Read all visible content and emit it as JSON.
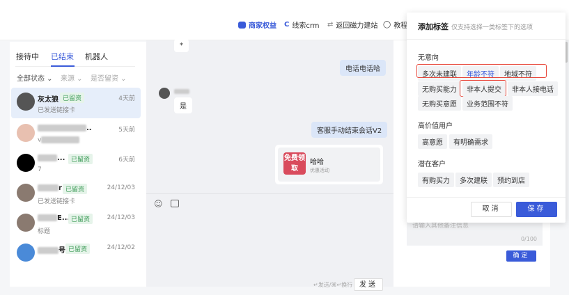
{
  "header": {
    "nav": [
      {
        "icon": "vip-icon",
        "label": "商家权益"
      },
      {
        "icon": "crm-icon",
        "label": "线索crm"
      },
      {
        "icon": "swap-icon",
        "label": "返回磁力建站"
      },
      {
        "icon": "tutorial-icon",
        "label": "教程"
      }
    ]
  },
  "sidebar": {
    "tabs": [
      "接待中",
      "已结束",
      "机器人"
    ],
    "filters": [
      "全部状态",
      "来源",
      "是否留资"
    ],
    "conversations": [
      {
        "name": "灰太狼",
        "badge": "已留资",
        "time": "4天前",
        "preview": "已发送链接卡"
      },
      {
        "name": "..",
        "badge": "",
        "time": "5天前",
        "preview": "v"
      },
      {
        "name": "...",
        "badge": "已留资",
        "time": "6天前",
        "preview": "7"
      },
      {
        "name": "r",
        "badge": "已留资",
        "time": "24/12/03",
        "preview": "已发送链接卡"
      },
      {
        "name": "E...",
        "badge": "已留资",
        "time": "24/12/03",
        "preview": "标题"
      },
      {
        "name": "号",
        "badge": "已留资",
        "time": "24/12/02",
        "preview": ""
      }
    ]
  },
  "chat": {
    "messages": [
      {
        "from": "user",
        "text": "*"
      },
      {
        "from": "agent",
        "text": "电话电话哈"
      },
      {
        "from": "user",
        "text": "是"
      },
      {
        "from": "agent",
        "text": "客服手动结束会话V2"
      }
    ],
    "card": {
      "image_text": "免费领取",
      "title": "哈哈",
      "subtitle": "优惠活动"
    },
    "composer": {
      "hint": "↵发送/⌘↵换行",
      "send": "发送"
    }
  },
  "remark": {
    "placeholder": "请输入其他备注信息",
    "count": "0/100",
    "confirm": "确定"
  },
  "modal": {
    "title": "添加标签",
    "subtitle": "仅支持选择一类标签下的选项",
    "groups": [
      {
        "name": "无意向",
        "tags": [
          "多次未建联",
          "年龄不符",
          "地域不符",
          "无购买能力",
          "非本人提交",
          "非本人接电话",
          "无购买意愿",
          "业务范围不符"
        ],
        "selected": "年龄不符"
      },
      {
        "name": "高价值用户",
        "tags": [
          "高意愿",
          "有明确需求"
        ]
      },
      {
        "name": "潜在客户",
        "tags": [
          "有购买力",
          "多次建联",
          "预约到店"
        ]
      }
    ],
    "cancel": "取消",
    "save": "保存"
  },
  "colors": {
    "accent": "#3a5bd9",
    "highlight": "#e8473a",
    "badge": "#3b9a55"
  }
}
